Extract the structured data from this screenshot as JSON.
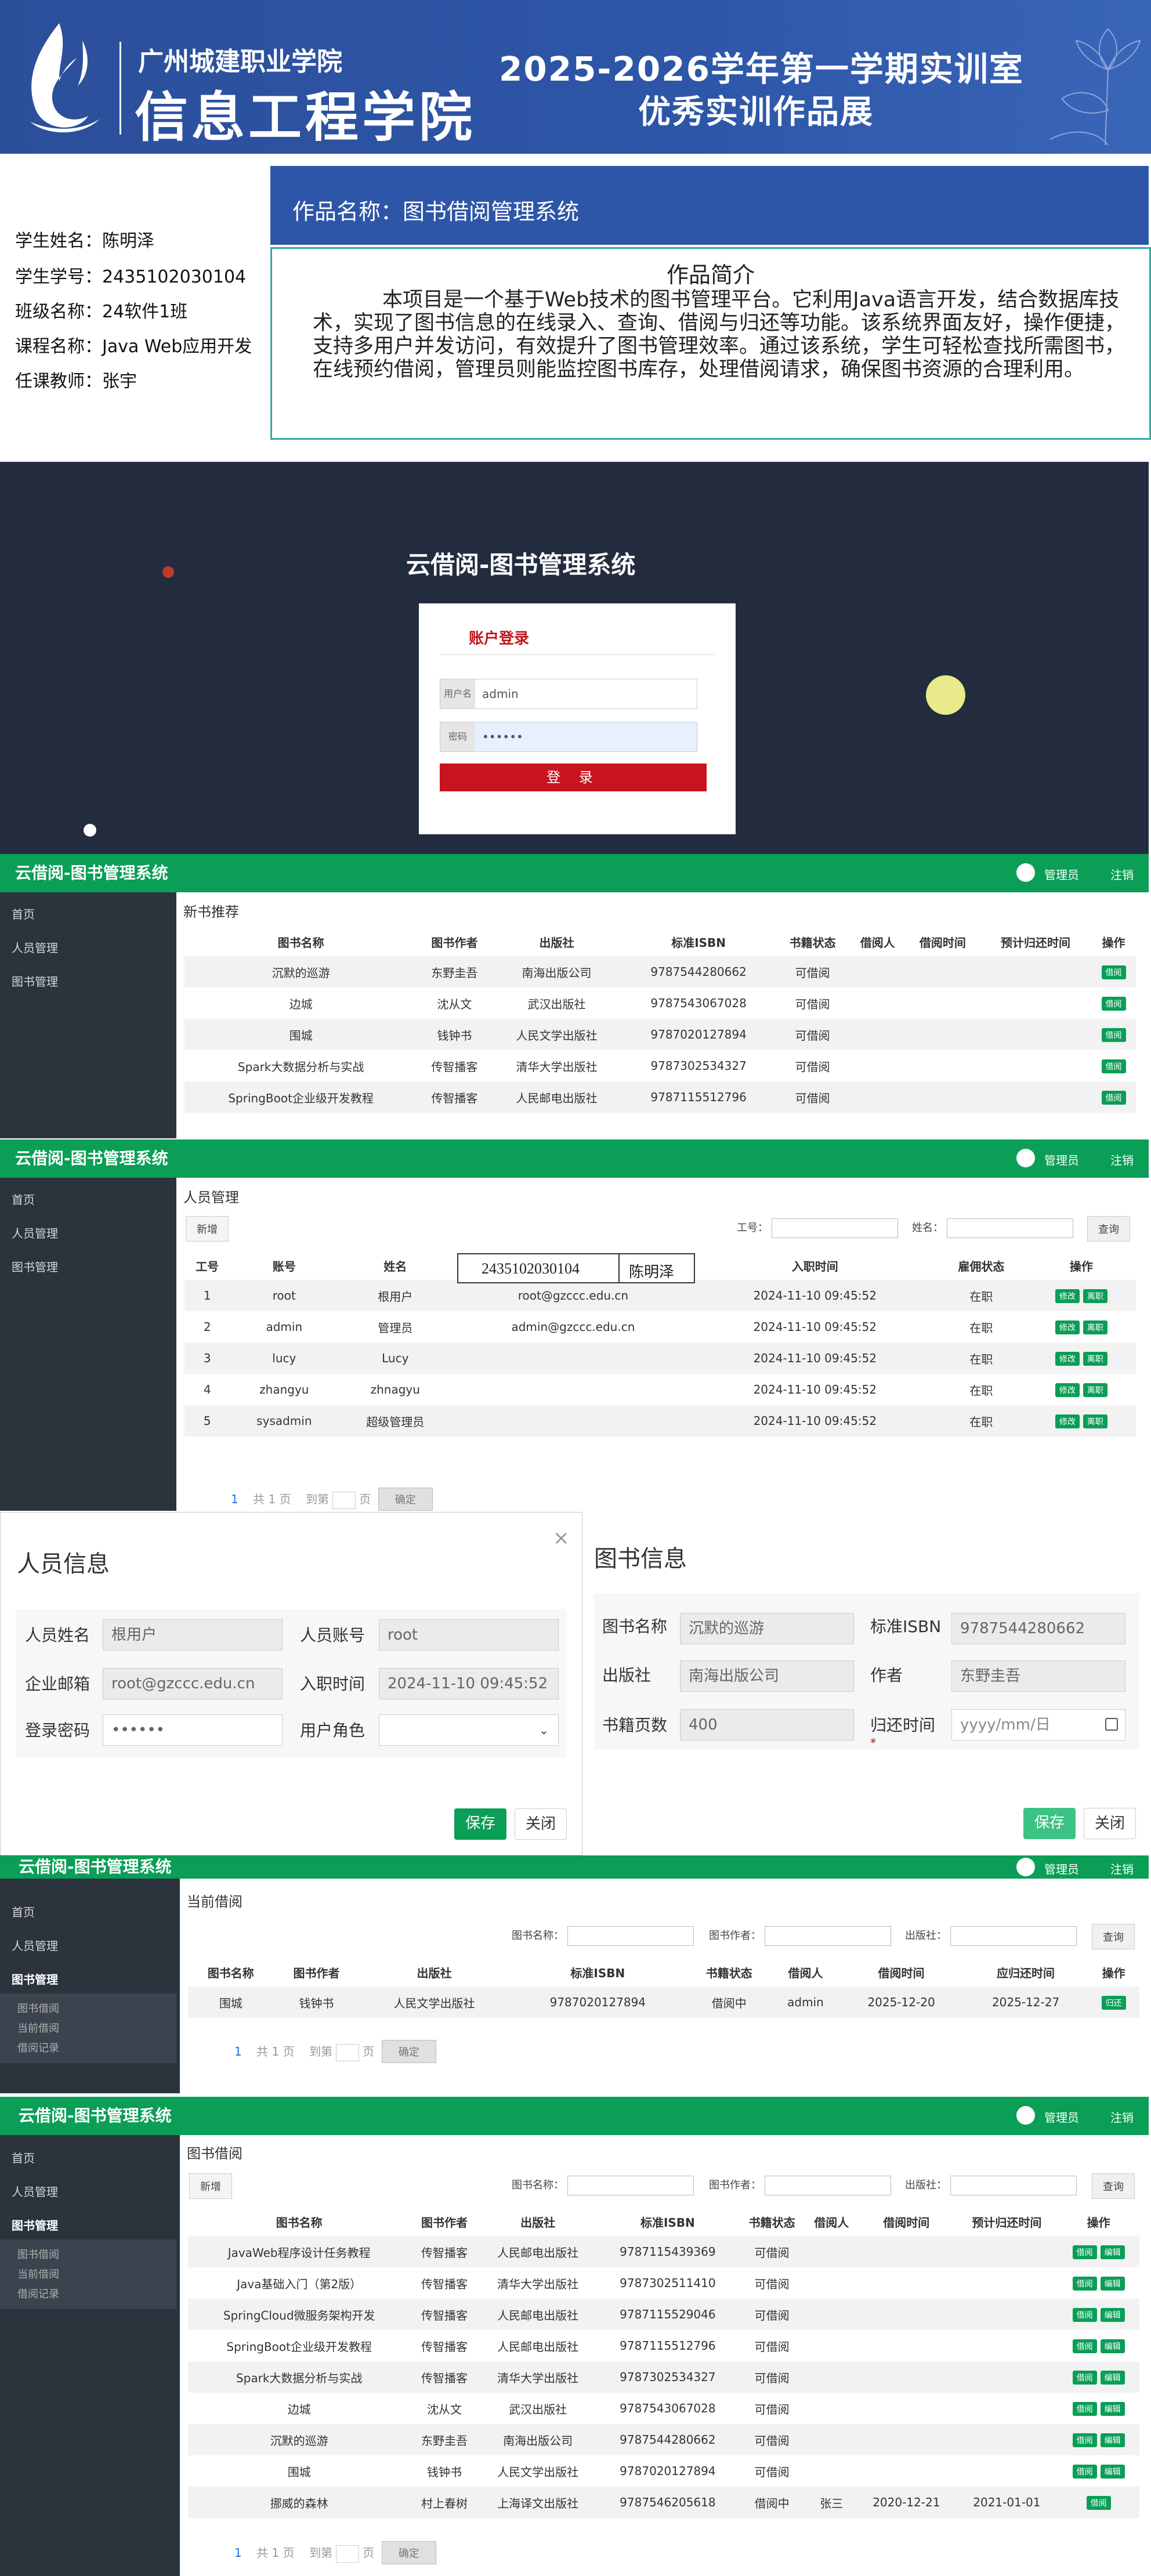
{
  "banner": {
    "school": "广州城建职业学院",
    "college": "信息工程学院",
    "title_line1": "2025-2026学年第一学期实训室",
    "title_line2": "优秀实训作品展"
  },
  "student": {
    "name": "学生姓名：陈明泽",
    "id": "学生学号：2435102030104",
    "class": "班级名称：24软件1班",
    "course": "课程名称：Java Web应用开发",
    "teacher": "任课教师：张宇"
  },
  "work": {
    "name": "作品名称：图书借阅管理系统",
    "intro_title": "作品简介",
    "intro_text": "本项目是一个基于Web技术的图书管理平台。它利用Java语言开发，结合数据库技术，实现了图书信息的在线录入、查询、借阅与归还等功能。该系统界面友好，操作便捷，支持多用户并发访问，有效提升了图书管理效率。通过该系统，学生可轻松查找所需图书，在线预约借阅，管理员则能监控图书库存，处理借阅请求，确保图书资源的合理利用。"
  },
  "login": {
    "title": "云借阅-图书管理系统",
    "box_title": "账户登录",
    "user_label": "用户名",
    "user_value": "admin",
    "pass_label": "密码",
    "pass_value": "••••••",
    "btn": "登 录"
  },
  "app": {
    "brand": "云借阅-图书管理系统",
    "user": "管理员",
    "logout": "注销",
    "menu_home": "首页",
    "menu_people": "人员管理",
    "menu_books": "图书管理",
    "sub_borrow": "图书借阅",
    "sub_current": "当前借阅",
    "sub_record": "借阅记录"
  },
  "new_books": {
    "title": "新书推荐",
    "headers": [
      "图书名称",
      "图书作者",
      "出版社",
      "标准ISBN",
      "书籍状态",
      "借阅人",
      "借阅时间",
      "预计归还时间",
      "操作"
    ],
    "rows": [
      [
        "沉默的巡游",
        "东野圭吾",
        "南海出版公司",
        "9787544280662",
        "可借阅",
        "",
        "",
        "",
        "借阅"
      ],
      [
        "边城",
        "沈从文",
        "武汉出版社",
        "9787543067028",
        "可借阅",
        "",
        "",
        "",
        "借阅"
      ],
      [
        "围城",
        "钱钟书",
        "人民文学出版社",
        "9787020127894",
        "可借阅",
        "",
        "",
        "",
        "借阅"
      ],
      [
        "Spark大数据分析与实战",
        "传智播客",
        "清华大学出版社",
        "9787302534327",
        "可借阅",
        "",
        "",
        "",
        "借阅"
      ],
      [
        "SpringBoot企业级开发教程",
        "传智播客",
        "人民邮电出版社",
        "9787115512796",
        "可借阅",
        "",
        "",
        "",
        "借阅"
      ]
    ]
  },
  "people": {
    "title": "人员管理",
    "add": "新增",
    "f_id": "工号：",
    "f_name": "姓名：",
    "query": "查询",
    "overlay_id": "2435102030104",
    "overlay_name": "陈明泽",
    "headers": [
      "工号",
      "账号",
      "姓名",
      "邮箱",
      "入职时间",
      "雇佣状态",
      "操作"
    ],
    "rows": [
      [
        "1",
        "root",
        "根用户",
        "root@gzccc.edu.cn",
        "2024-11-10 09:45:52",
        "在职"
      ],
      [
        "2",
        "admin",
        "管理员",
        "admin@gzccc.edu.cn",
        "2024-11-10 09:45:52",
        "在职"
      ],
      [
        "3",
        "lucy",
        "Lucy",
        "",
        "2024-11-10 09:45:52",
        "在职"
      ],
      [
        "4",
        "zhangyu",
        "zhnagyu",
        "",
        "2024-11-10 09:45:52",
        "在职"
      ],
      [
        "5",
        "sysadmin",
        "超级管理员",
        "",
        "2024-11-10 09:45:52",
        "在职"
      ]
    ],
    "edit": "修改",
    "leave": "离职"
  },
  "pager": {
    "cur": "1",
    "total": "共 1 页",
    "goto": "到第",
    "page": "页",
    "ok": "确定"
  },
  "person_form": {
    "title": "人员信息",
    "close": "×",
    "name_label": "人员姓名",
    "name_value": "根用户",
    "account_label": "人员账号",
    "account_value": "root",
    "email_label": "企业邮箱",
    "email_value": "root@gzccc.edu.cn",
    "date_label": "入职时间",
    "date_value": "2024-11-10 09:45:52",
    "pass_label": "登录密码",
    "pass_value": "••••••",
    "role_label": "用户角色",
    "save": "保存",
    "close_btn": "关闭"
  },
  "book_form": {
    "title": "图书信息",
    "name_label": "图书名称",
    "name_value": "沉默的巡游",
    "isbn_label": "标准ISBN",
    "isbn_value": "9787544280662",
    "press_label": "出版社",
    "press_value": "南海出版公司",
    "author_label": "作者",
    "author_value": "东野圭吾",
    "pages_label": "书籍页数",
    "pages_value": "400",
    "return_label": "归还时间",
    "return_placeholder": "yyyy/mm/日",
    "save": "保存",
    "close_btn": "关闭"
  },
  "current": {
    "title": "当前借阅",
    "f_name": "图书名称：",
    "f_author": "图书作者：",
    "f_press": "出版社：",
    "query": "查询",
    "headers": [
      "图书名称",
      "图书作者",
      "出版社",
      "标准ISBN",
      "书籍状态",
      "借阅人",
      "借阅时间",
      "应归还时间",
      "操作"
    ],
    "rows": [
      [
        "围城",
        "钱钟书",
        "人民文学出版社",
        "9787020127894",
        "借阅中",
        "admin",
        "2025-12-20",
        "2025-12-27",
        "归还"
      ]
    ]
  },
  "borrow": {
    "title": "图书借阅",
    "add": "新增",
    "headers": [
      "图书名称",
      "图书作者",
      "出版社",
      "标准ISBN",
      "书籍状态",
      "借阅人",
      "借阅时间",
      "预计归还时间",
      "操作"
    ],
    "rows": [
      [
        "JavaWeb程序设计任务教程",
        "传智播客",
        "人民邮电出版社",
        "9787115439369",
        "可借阅",
        "",
        "",
        ""
      ],
      [
        "Java基础入门（第2版）",
        "传智播客",
        "清华大学出版社",
        "9787302511410",
        "可借阅",
        "",
        "",
        ""
      ],
      [
        "SpringCloud微服务架构开发",
        "传智播客",
        "人民邮电出版社",
        "9787115529046",
        "可借阅",
        "",
        "",
        ""
      ],
      [
        "SpringBoot企业级开发教程",
        "传智播客",
        "人民邮电出版社",
        "9787115512796",
        "可借阅",
        "",
        "",
        ""
      ],
      [
        "Spark大数据分析与实战",
        "传智播客",
        "清华大学出版社",
        "9787302534327",
        "可借阅",
        "",
        "",
        ""
      ],
      [
        "边城",
        "沈从文",
        "武汉出版社",
        "9787543067028",
        "可借阅",
        "",
        "",
        ""
      ],
      [
        "沉默的巡游",
        "东野圭吾",
        "南海出版公司",
        "9787544280662",
        "可借阅",
        "",
        "",
        ""
      ],
      [
        "围城",
        "钱钟书",
        "人民文学出版社",
        "9787020127894",
        "可借阅",
        "",
        "",
        ""
      ],
      [
        "挪威的森林",
        "村上春树",
        "上海译文出版社",
        "9787546205618",
        "借阅中",
        "张三",
        "2020-12-21",
        "2021-01-01"
      ]
    ],
    "btn_borrow": "借阅",
    "btn_edit": "编辑"
  }
}
